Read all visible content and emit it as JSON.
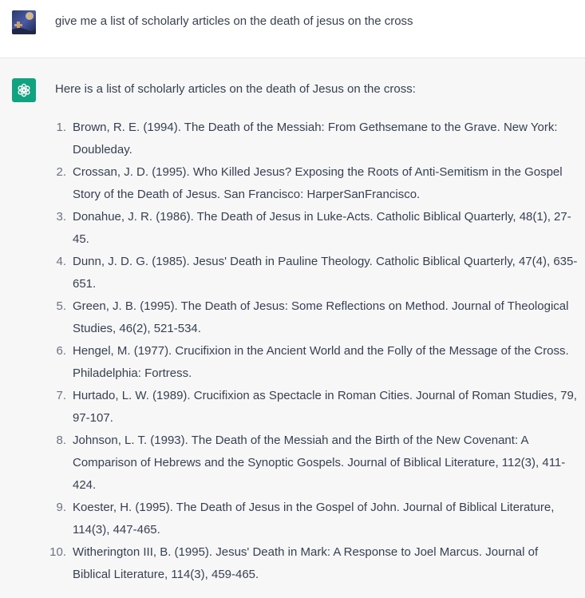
{
  "user_message": {
    "text": "give me a list of scholarly articles on the death of jesus on the cross"
  },
  "assistant_message": {
    "intro": "Here is a list of scholarly articles on the death of Jesus on the cross:",
    "references": [
      {
        "num": "1.",
        "text": "Brown, R. E. (1994). The Death of the Messiah: From Gethsemane to the Grave. New York: Doubleday."
      },
      {
        "num": "2.",
        "text": "Crossan, J. D. (1995). Who Killed Jesus? Exposing the Roots of Anti-Semitism in the Gospel Story of the Death of Jesus. San Francisco: HarperSanFrancisco."
      },
      {
        "num": "3.",
        "text": "Donahue, J. R. (1986). The Death of Jesus in Luke-Acts. Catholic Biblical Quarterly, 48(1), 27-45."
      },
      {
        "num": "4.",
        "text": "Dunn, J. D. G. (1985). Jesus' Death in Pauline Theology. Catholic Biblical Quarterly, 47(4), 635-651."
      },
      {
        "num": "5.",
        "text": "Green, J. B. (1995). The Death of Jesus: Some Reflections on Method. Journal of Theological Studies, 46(2), 521-534."
      },
      {
        "num": "6.",
        "text": "Hengel, M. (1977). Crucifixion in the Ancient World and the Folly of the Message of the Cross. Philadelphia: Fortress."
      },
      {
        "num": "7.",
        "text": "Hurtado, L. W. (1989). Crucifixion as Spectacle in Roman Cities. Journal of Roman Studies, 79, 97-107."
      },
      {
        "num": "8.",
        "text": "Johnson, L. T. (1993). The Death of the Messiah and the Birth of the New Covenant: A Comparison of Hebrews and the Synoptic Gospels. Journal of Biblical Literature, 112(3), 411-424."
      },
      {
        "num": "9.",
        "text": "Koester, H. (1995). The Death of Jesus in the Gospel of John. Journal of Biblical Literature, 114(3), 447-465."
      },
      {
        "num": "10.",
        "text": "Witherington III, B. (1995). Jesus' Death in Mark: A Response to Joel Marcus. Journal of Biblical Literature, 114(3), 459-465."
      }
    ]
  },
  "icons": {
    "user_avatar": "user-avatar-photo",
    "assistant_avatar": "openai-logo-icon"
  },
  "colors": {
    "assistant_bg": "#f7f7f8",
    "assistant_avatar_bg": "#10a37f",
    "text": "#374151"
  }
}
